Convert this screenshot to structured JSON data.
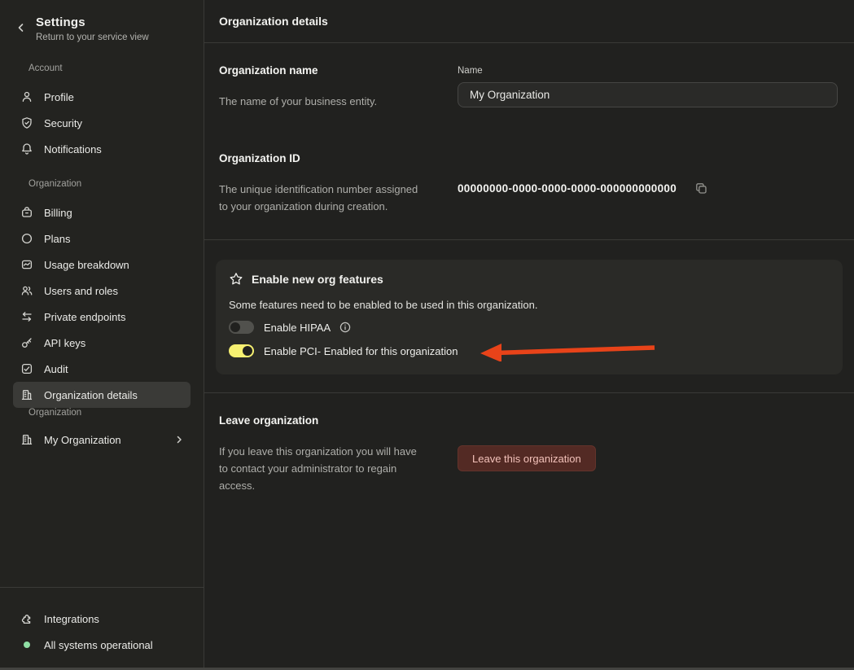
{
  "sidebar": {
    "title": "Settings",
    "subtitle": "Return to your service view",
    "account": {
      "label": "Account",
      "items": [
        {
          "label": "Profile",
          "icon": "user-icon"
        },
        {
          "label": "Security",
          "icon": "shield-icon"
        },
        {
          "label": "Notifications",
          "icon": "bell-icon"
        }
      ]
    },
    "organization": {
      "label": "Organization",
      "items": [
        {
          "label": "Billing",
          "icon": "billing-icon"
        },
        {
          "label": "Plans",
          "icon": "circle-icon"
        },
        {
          "label": "Usage breakdown",
          "icon": "usage-chart-icon"
        },
        {
          "label": "Users and roles",
          "icon": "users-icon"
        },
        {
          "label": "Private endpoints",
          "icon": "swap-arrows-icon"
        },
        {
          "label": "API keys",
          "icon": "key-icon"
        },
        {
          "label": "Audit",
          "icon": "audit-icon"
        },
        {
          "label": "Organization details",
          "icon": "building-icon",
          "selected": true
        }
      ]
    },
    "org_switcher": {
      "label": "Organization",
      "value": "My Organization",
      "icon": "building-icon"
    },
    "footer": {
      "integrations_label": "Integrations",
      "status_label": "All systems operational",
      "status_color": "#8fdfa4"
    }
  },
  "main": {
    "header_title": "Organization details",
    "org_name": {
      "title": "Organization name",
      "description": "The name of your business entity.",
      "field_label": "Name",
      "field_value": "My Organization"
    },
    "org_id": {
      "title": "Organization ID",
      "description": "The unique identification number assigned to your organization during creation.",
      "value": "00000000-0000-0000-0000-000000000000"
    },
    "features": {
      "title": "Enable new org features",
      "description": "Some features need to be enabled to be used in this organization.",
      "toggles": [
        {
          "label": "Enable HIPAA",
          "enabled": false,
          "has_info": true
        },
        {
          "label": "Enable PCI- Enabled for this organization",
          "enabled": true,
          "has_info": false
        }
      ]
    },
    "leave": {
      "title": "Leave organization",
      "description": "If you leave this organization you will have to contact your administrator to regain access.",
      "button_label": "Leave this organization"
    }
  },
  "colors": {
    "background": "#21211f",
    "sidebar_background": "#232320",
    "card_background": "#2a2a27",
    "selected_item": "#3a3a37",
    "toggle_on": "#f6f071",
    "toggle_off": "#51514d",
    "arrow_annotation": "#e84319",
    "danger_button_bg": "#532a24",
    "danger_button_text": "#f3c2ba",
    "status_dot": "#8fdfa4"
  }
}
